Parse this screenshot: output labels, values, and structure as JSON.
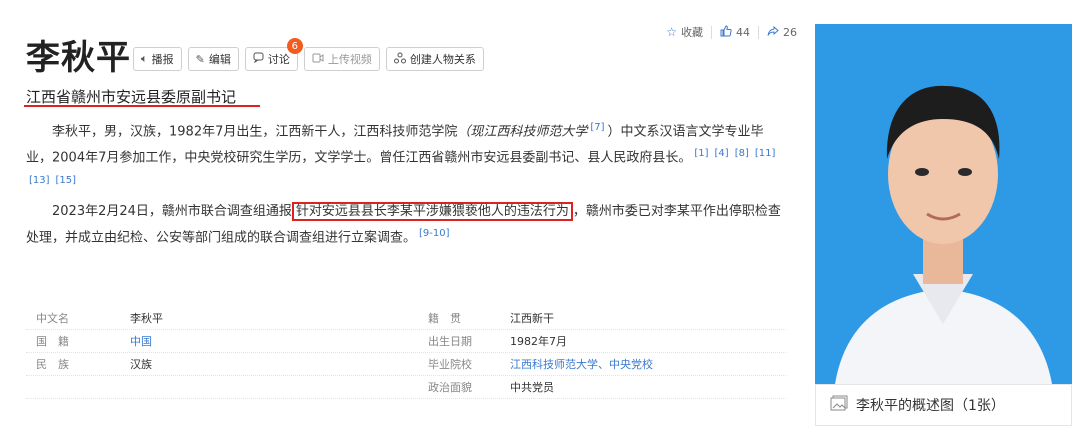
{
  "stats": {
    "collect_label": "收藏",
    "likes": "44",
    "shares": "26",
    "icons": [
      "star-icon",
      "thumb-up-icon",
      "share-icon"
    ]
  },
  "title": "李秋平",
  "buttons": {
    "broadcast": "播报",
    "edit": "编辑",
    "discuss": "讨论",
    "discuss_badge": "6",
    "upload_video": "上传视频",
    "create_relation": "创建人物关系"
  },
  "subtitle": "江西省赣州市安远县委原副书记",
  "para1": {
    "text_a": "李秋平，男，汉族，1982年7月出生，江西新干人，江西科技师范学院",
    "italic": "（现江西科技师范大学",
    "ref_a": "[7]",
    "text_b": "）中文系汉语言文学专业毕业，2004年7月参加工作，中央党校研究生学历，文学学士。曾任江西省赣州市安远县委副书记、县人民政府县长。",
    "refs": [
      "[1]",
      "[4]",
      "[8]",
      "[11]",
      "[13]",
      "[15]"
    ]
  },
  "para2": {
    "text_a": "2023年2月24日，赣州市联合调查组通报",
    "boxed": "针对安远县县长李某平涉嫌猥亵他人的违法行为",
    "text_b": "，赣州市委已对李某平作出停职检查处理，并成立由纪检、公安等部门组成的联合调查组进行立案调查。",
    "ref": "[9-10]"
  },
  "info_rows": [
    {
      "k1": "中文名",
      "v1": "李秋平",
      "k2": "籍　贯",
      "v2": "江西新干"
    },
    {
      "k1": "国　籍",
      "v1": "中国",
      "k2": "出生日期",
      "v2": "1982年7月"
    },
    {
      "k1": "民　族",
      "v1": "汉族",
      "k2": "毕业院校",
      "v2": "江西科技师范大学、中央党校"
    },
    {
      "k1": "",
      "v1": "",
      "k2": "政治面貌",
      "v2": "中共党员"
    }
  ],
  "caption": "李秋平的概述图（1张）",
  "colors": {
    "accent": "#3a79d0",
    "highlight": "#dd2222",
    "photo_bg": "#2e9ae6",
    "badge": "#f25c1f"
  }
}
